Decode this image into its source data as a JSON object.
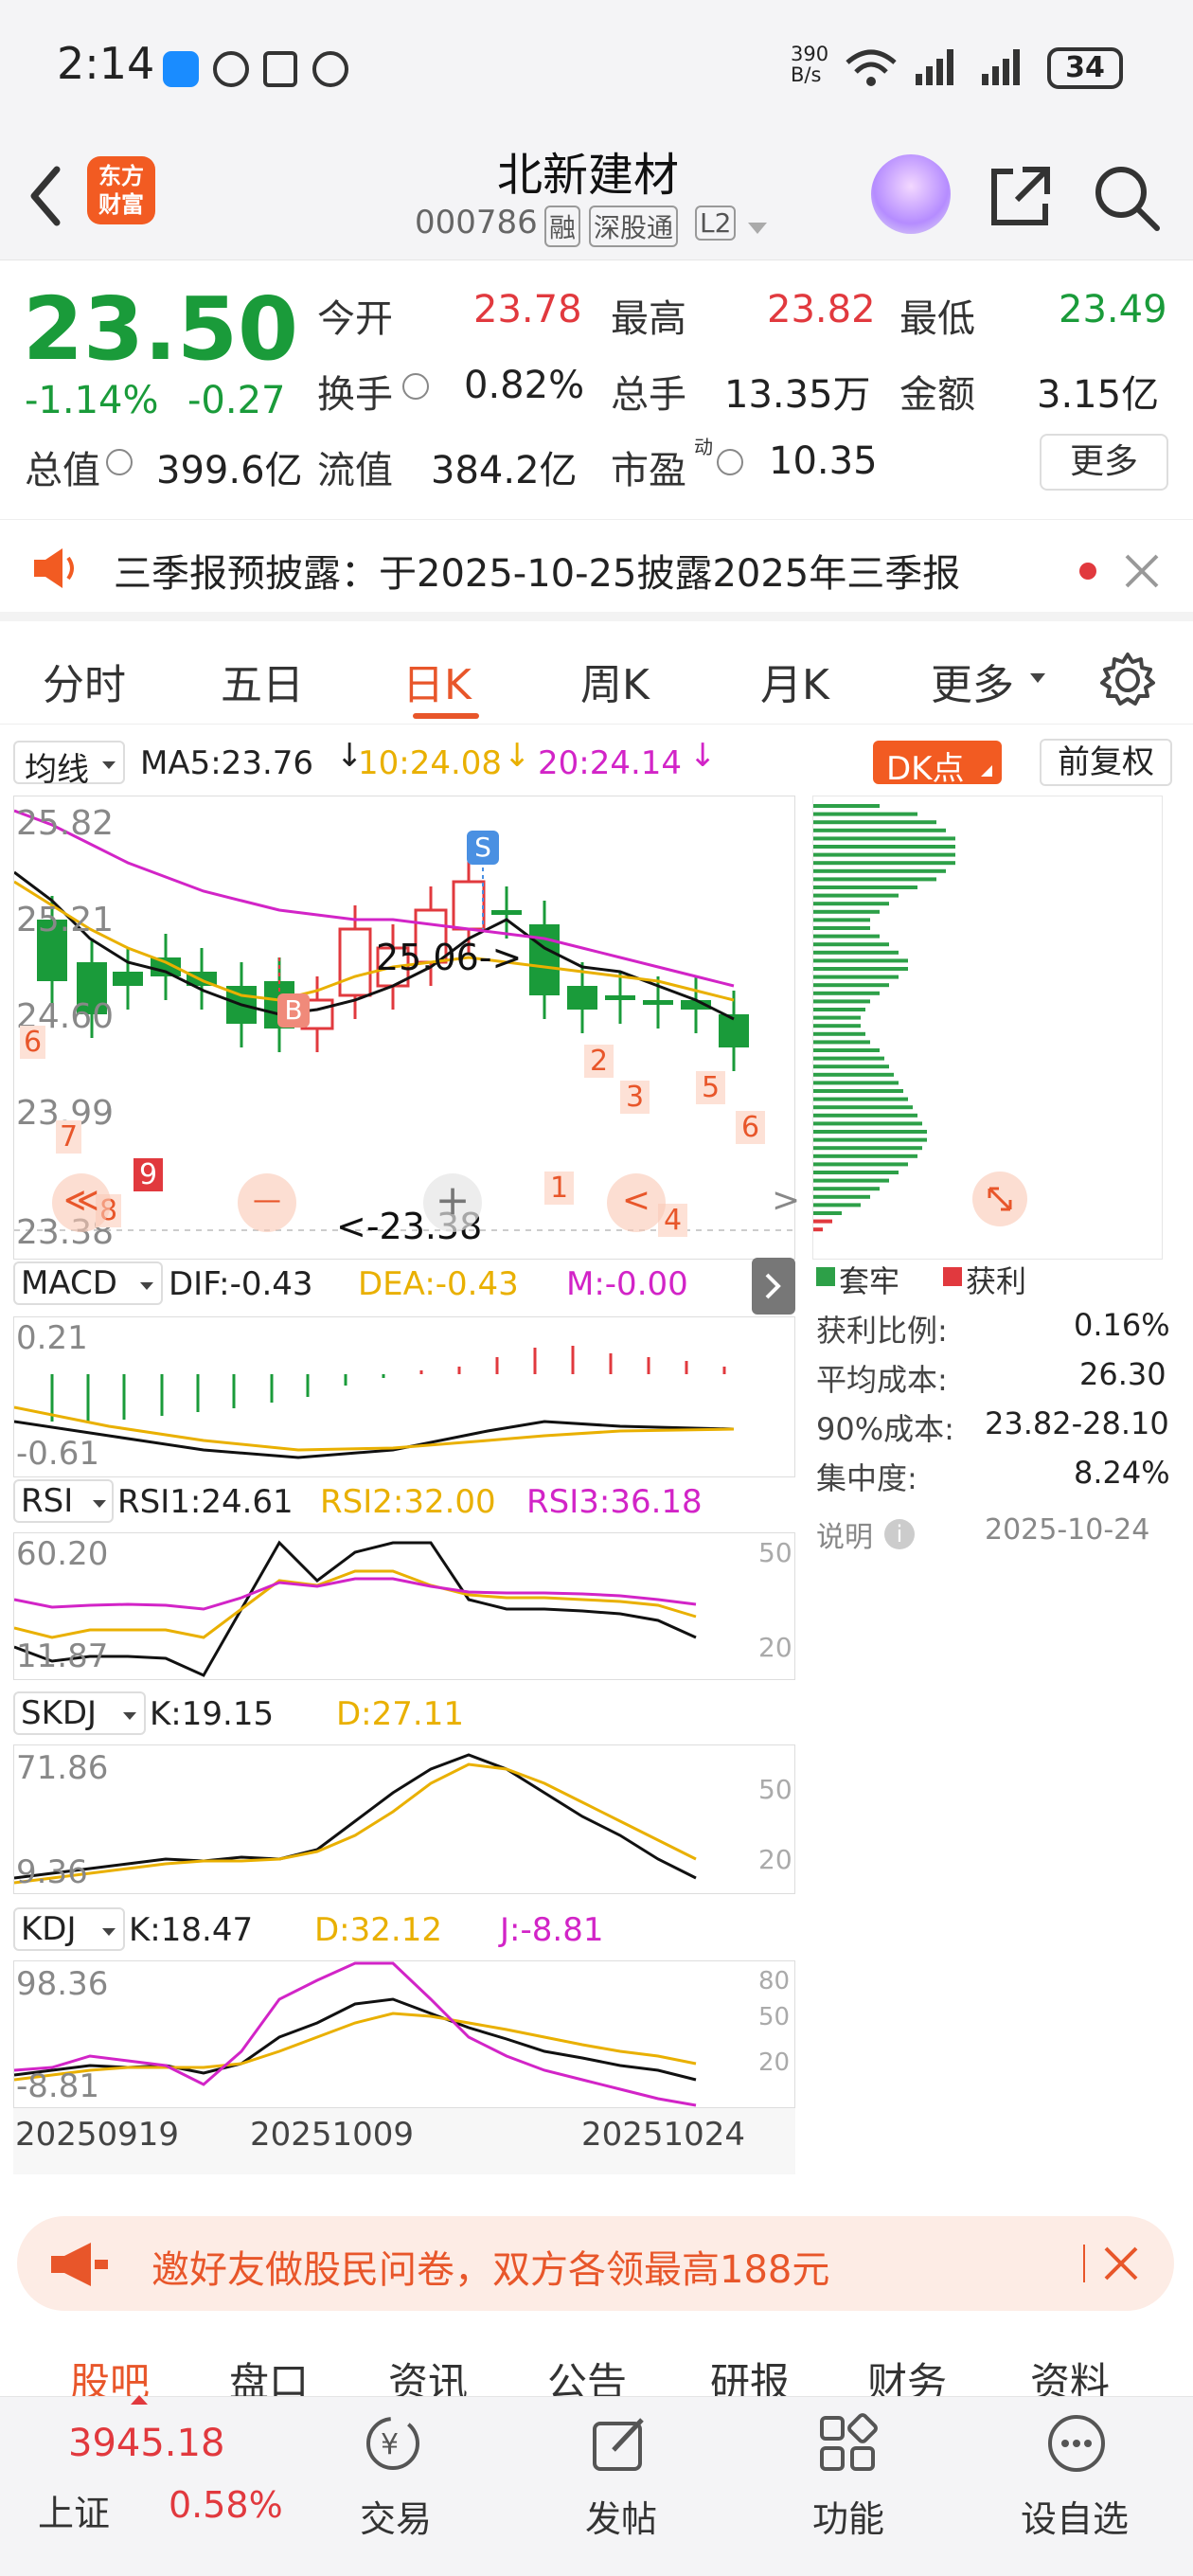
{
  "status_bar": {
    "time": "2:14",
    "net_speed_top": "390",
    "net_speed_bottom": "B/s",
    "battery": "34"
  },
  "header": {
    "title": "北新建材",
    "code": "000786",
    "badges": [
      "融",
      "深股通",
      "L2"
    ],
    "logo_line1": "东方",
    "logo_line2": "财富"
  },
  "quote": {
    "price": "23.50",
    "change_pct": "-1.14%",
    "change": "-0.27",
    "open_label": "今开",
    "open": "23.78",
    "high_label": "最高",
    "high": "23.82",
    "low_label": "最低",
    "low": "23.49",
    "turnover_label": "换手",
    "turnover": "0.82%",
    "volume_label": "总手",
    "volume": "13.35万",
    "amount_label": "金额",
    "amount": "3.15亿",
    "mktcap_label": "总值",
    "mktcap": "399.6亿",
    "float_label": "流值",
    "float": "384.2亿",
    "pe_label": "市盈",
    "pe_sup": "动",
    "pe": "10.35",
    "more_button": "更多"
  },
  "notice": {
    "text": "三季报预披露：于2025-10-25披露2025年三季报"
  },
  "tabs": [
    {
      "label": "分时"
    },
    {
      "label": "五日"
    },
    {
      "label": "日K"
    },
    {
      "label": "周K"
    },
    {
      "label": "月K"
    },
    {
      "label": "更多"
    }
  ],
  "kchart": {
    "indicator_select": "均线",
    "ma5": "MA5:23.76",
    "ma10": "10:24.08",
    "ma20": "20:24.14",
    "dk_button": "DK点",
    "adjust_button": "前复权",
    "y_ticks": [
      "25.82",
      "25.21",
      "24.60",
      "23.99",
      "23.38"
    ],
    "high_marker": "25.06->",
    "low_marker": "<-23.38",
    "marker_s": "S",
    "marker_b": "B",
    "seq_left": [
      "6",
      "7",
      "8",
      "9"
    ],
    "seq_right": [
      "1",
      "2",
      "3",
      "4",
      "5",
      "6"
    ],
    "nav_left": "≪",
    "nav_minus": "—",
    "nav_plus": "+",
    "nav_prev": "<",
    "nav_next": ">"
  },
  "chip": {
    "legend_trapped": "套牢",
    "legend_profit": "获利",
    "rows": [
      {
        "label": "获利比例:",
        "value": "0.16%"
      },
      {
        "label": "平均成本:",
        "value": "26.30"
      },
      {
        "label": "90%成本:",
        "value": "23.82-28.10"
      },
      {
        "label": "集中度:",
        "value": "8.24%"
      }
    ],
    "note_label": "说明",
    "date": "2025-10-24"
  },
  "macd": {
    "select": "MACD",
    "dif": "DIF:-0.43",
    "dea": "DEA:-0.43",
    "m": "M:-0.00",
    "y_top": "0.21",
    "y_bottom": "-0.61"
  },
  "rsi": {
    "select": "RSI",
    "rsi1": "RSI1:24.61",
    "rsi2": "RSI2:32.00",
    "rsi3": "RSI3:36.18",
    "y_top": "60.20",
    "y_bottom": "11.87",
    "ref_high": "50",
    "ref_low": "20"
  },
  "skdj": {
    "select": "SKDJ",
    "k": "K:19.15",
    "d": "D:27.11",
    "y_top": "71.86",
    "y_bottom": "9.36",
    "ref_high": "50",
    "ref_low": "20"
  },
  "kdj": {
    "select": "KDJ",
    "k": "K:18.47",
    "d": "D:32.12",
    "j": "J:-8.81",
    "y_top": "98.36",
    "y_bottom": "-8.81",
    "ref1": "80",
    "ref2": "50",
    "ref3": "20"
  },
  "x_dates": [
    "20250919",
    "20251009",
    "20251024"
  ],
  "banner": {
    "text": "邀好友做股民问卷，双方各领最高188元"
  },
  "bottom_tabs": [
    "股吧",
    "盘口",
    "资讯",
    "公告",
    "研报",
    "财务",
    "资料"
  ],
  "navbar": {
    "index_value": "3945.18",
    "index_name": "上证",
    "index_change": "0.58%",
    "items": [
      {
        "label": "交易"
      },
      {
        "label": "发帖"
      },
      {
        "label": "功能"
      },
      {
        "label": "设自选"
      }
    ]
  },
  "colors": {
    "up": "#e1393e",
    "down": "#1a9b3a",
    "accent": "#e8562a",
    "ma10": "#e9b000",
    "ma20": "#d224c7"
  }
}
